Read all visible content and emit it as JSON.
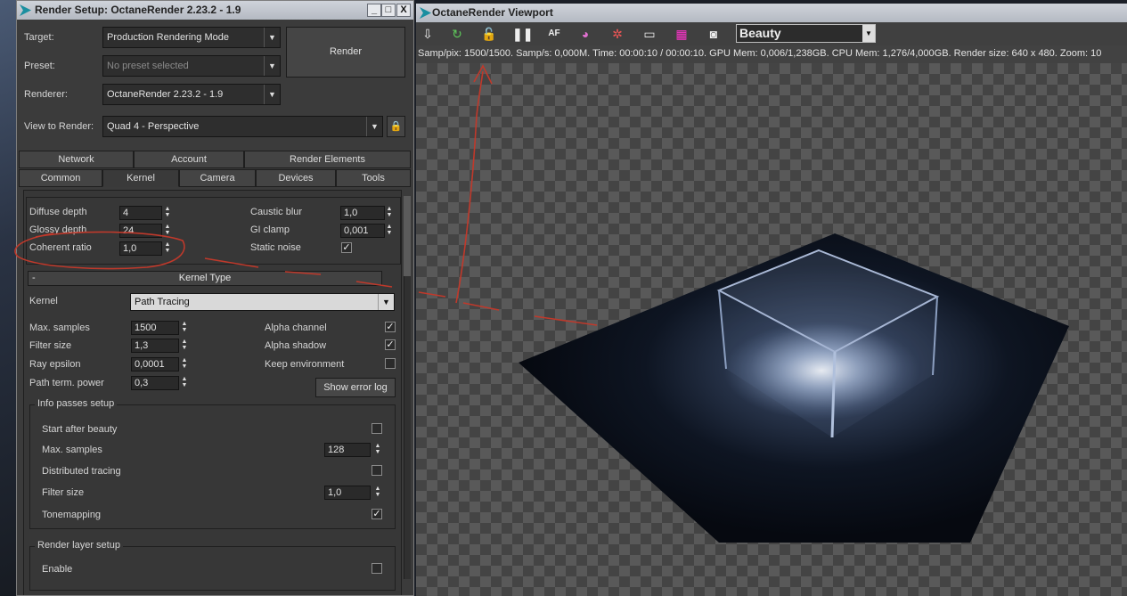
{
  "render_setup": {
    "title": "Render Setup: OctaneRender 2.23.2 - 1.9",
    "window_buttons": {
      "minimize": "_",
      "maximize": "□",
      "close": "X"
    },
    "target": {
      "label": "Target:",
      "value": "Production Rendering Mode"
    },
    "preset": {
      "label": "Preset:",
      "value": "No preset selected"
    },
    "renderer": {
      "label": "Renderer:",
      "value": "OctaneRender 2.23.2 - 1.9"
    },
    "view_to_render": {
      "label": "View to Render:",
      "value": "Quad 4 - Perspective"
    },
    "render_button": "Render",
    "tabs_row1": [
      "Network",
      "Account",
      "Render Elements"
    ],
    "tabs_row2": [
      "Common",
      "Kernel",
      "Camera",
      "Devices",
      "Tools"
    ],
    "active_tab": "Kernel",
    "top_params": {
      "diffuse_depth": {
        "label": "Diffuse depth",
        "value": "4"
      },
      "glossy_depth": {
        "label": "Glossy depth",
        "value": "24"
      },
      "coherent_ratio": {
        "label": "Coherent ratio",
        "value": "1,0"
      },
      "caustic_blur": {
        "label": "Caustic blur",
        "value": "1,0"
      },
      "gi_clamp": {
        "label": "GI clamp",
        "value": "0,001"
      },
      "static_noise": {
        "label": "Static noise",
        "checked": true
      }
    },
    "kernel_type": {
      "rollout_title": "Kernel Type",
      "collapse_symbol": "-",
      "kernel": {
        "label": "Kernel",
        "value": "Path Tracing"
      },
      "max_samples": {
        "label": "Max. samples",
        "value": "1500"
      },
      "filter_size": {
        "label": "Filter size",
        "value": "1,3"
      },
      "ray_epsilon": {
        "label": "Ray epsilon",
        "value": "0,0001"
      },
      "path_term_power": {
        "label": "Path term. power",
        "value": "0,3"
      },
      "alpha_channel": {
        "label": "Alpha channel",
        "checked": true
      },
      "alpha_shadow": {
        "label": "Alpha shadow",
        "checked": true
      },
      "keep_environment": {
        "label": "Keep environment",
        "checked": false
      },
      "show_error_log": "Show error log"
    },
    "info_passes": {
      "title": "Info passes setup",
      "start_after_beauty": {
        "label": "Start after beauty",
        "checked": false
      },
      "max_samples": {
        "label": "Max. samples",
        "value": "128"
      },
      "distributed_tracing": {
        "label": "Distributed tracing",
        "checked": false
      },
      "filter_size": {
        "label": "Filter size",
        "value": "1,0"
      },
      "tonemapping": {
        "label": "Tonemapping",
        "checked": true
      }
    },
    "render_layer": {
      "title": "Render layer setup",
      "enable": {
        "label": "Enable",
        "checked": false
      }
    }
  },
  "viewport": {
    "title": "OctaneRender Viewport",
    "pass_select": "Beauty",
    "toolbar_icons": [
      "save-icon",
      "restart-icon",
      "lock-icon",
      "pause-icon",
      "af-focus-icon",
      "color-picker-icon",
      "material-picker-icon",
      "region-icon",
      "film-region-icon",
      "camera-icon"
    ],
    "stats": "Samp/pix: 1500/1500.   Samp/s: 0,000M.   Time: 00:00:10 / 00:00:10.   GPU Mem: 0,006/1,238GB.   CPU Mem: 1,276/4,000GB.   Render size: 640 x 480.   Zoom: 10"
  },
  "colors": {
    "panel_bg": "#3b3b3b",
    "annotation": "#c0392b"
  }
}
